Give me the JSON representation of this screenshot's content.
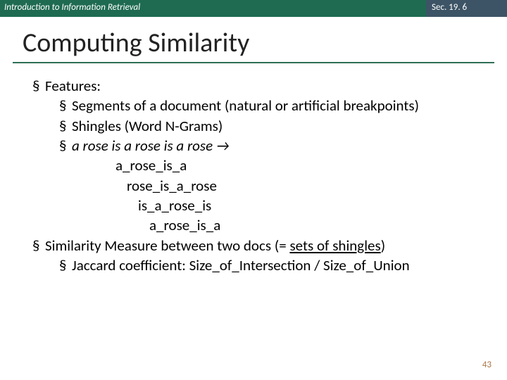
{
  "header": {
    "left": "Introduction to Information Retrieval",
    "right": "Sec. 19. 6"
  },
  "title": "Computing Similarity",
  "bullets": {
    "features": "Features:",
    "segments": "Segments of a document (natural or artificial breakpoints)",
    "shingles": "Shingles (Word N-Grams)",
    "rose_example": "a rose is a rose is a rose →",
    "sh1": "a_rose_is_a",
    "sh2": "rose_is_a_rose",
    "sh3": "is_a_rose_is",
    "sh4": "a_rose_is_a",
    "similarity_pre": "Similarity Measure between two docs (= ",
    "similarity_underline": "sets of shingles",
    "similarity_post": ")",
    "jaccard": "Jaccard coefficient: Size_of_Intersection / Size_of_Union"
  },
  "page_number": "43",
  "glyph": "§"
}
